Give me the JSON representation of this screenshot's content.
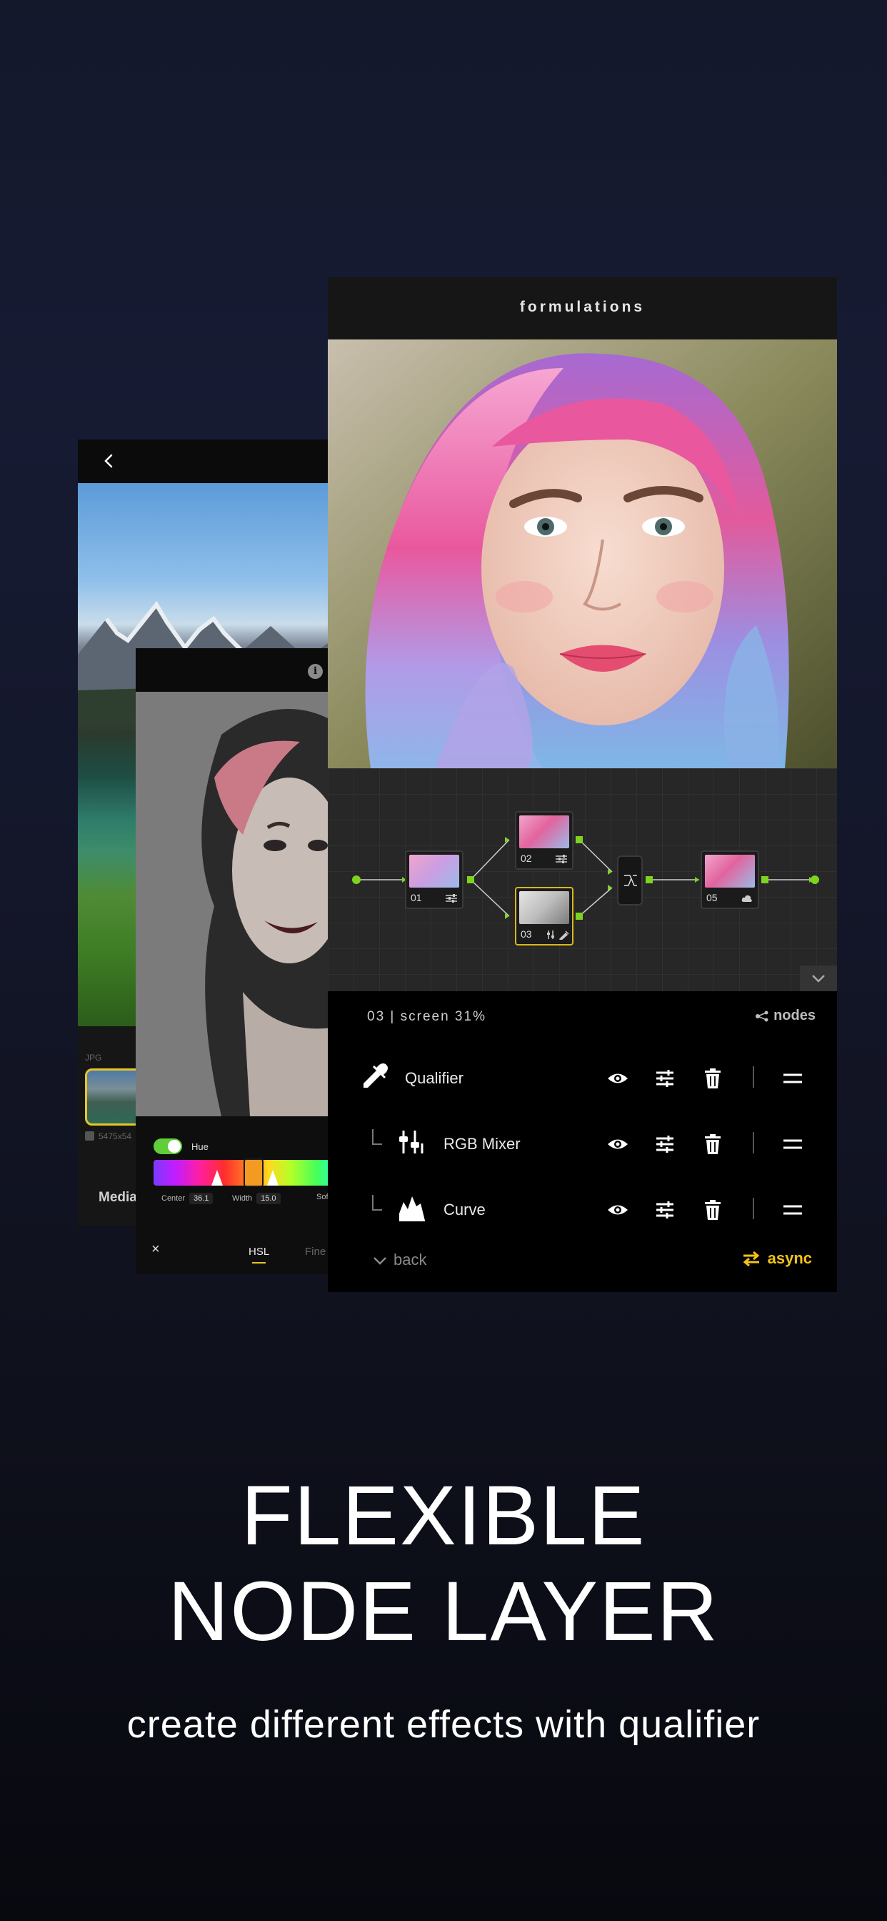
{
  "headline": {
    "line1": "FLEXIBLE",
    "line2": "NODE LAYER",
    "subtitle": "create different effects  with qualifier"
  },
  "media_panel": {
    "format_label": "JPG",
    "dimensions": "5475x54",
    "media_label": "Media",
    "back_icon": "chevron-left-icon"
  },
  "hsl_panel": {
    "toggle_on": true,
    "hue_label": "Hue",
    "center_label": "Center",
    "center_value": "36.1",
    "width_label": "Width",
    "width_value": "15.0",
    "soft_label": "Sof",
    "close_symbol": "×",
    "tab_hsl": "HSL",
    "tab_fine": "Fine",
    "accent_color": "#e8c528"
  },
  "formulations": {
    "title": "formulations",
    "nodes": [
      {
        "num": "01",
        "icon": "sliders-icon"
      },
      {
        "num": "02",
        "icon": "sliders-icon"
      },
      {
        "num": "03",
        "icon": "rgb-mixer-icon",
        "selected": true
      },
      {
        "num": "05",
        "icon": "cloud-icon"
      }
    ],
    "status_text": "03  |  screen 31%",
    "nodes_label": "nodes",
    "layers": [
      {
        "name": "Qualifier",
        "icon": "eyedropper-icon"
      },
      {
        "name": "RGB Mixer",
        "icon": "rgb-mixer-icon"
      },
      {
        "name": "Curve",
        "icon": "curve-histogram-icon"
      }
    ],
    "back_label": "back",
    "async_label": "async",
    "accent_color": "#f2c318",
    "port_color": "#7ed321"
  }
}
